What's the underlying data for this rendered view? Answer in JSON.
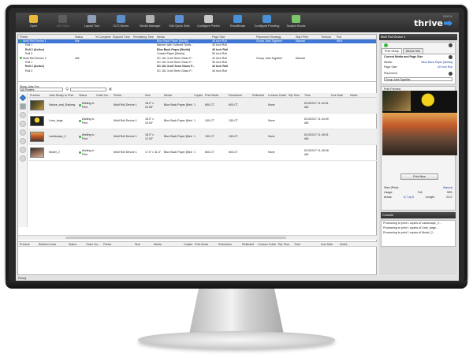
{
  "toolbar": {
    "buttons": [
      {
        "label": "Open",
        "icon": "folder-icon",
        "color": "#e8b93a",
        "disabled": false
      },
      {
        "label": "Job Editor",
        "icon": "job-editor-icon",
        "color": "#7a7a7a",
        "disabled": true
      },
      {
        "label": "Layout Tool",
        "icon": "layout-tool-icon",
        "color": "#8fa0b5",
        "disabled": false
      },
      {
        "label": "CUT-Server",
        "icon": "cut-server-icon",
        "color": "#5c8fc8",
        "disabled": false
      },
      {
        "label": "Media Manager",
        "icon": "media-manager-icon",
        "color": "#b0b0b0",
        "disabled": false
      },
      {
        "label": "Edit Quick Sets",
        "icon": "quick-sets-icon",
        "color": "#5d8fd6",
        "disabled": false
      },
      {
        "label": "Configure Printer",
        "icon": "printer-icon",
        "color": "#c8c8c8",
        "disabled": false
      },
      {
        "label": "Recalibrate",
        "icon": "recalibrate-icon",
        "color": "#4a90d9",
        "disabled": false
      },
      {
        "label": "Configure Proofing",
        "icon": "proofing-icon",
        "color": "#4a90d9",
        "disabled": false
      },
      {
        "label": "Swatch Books",
        "icon": "swatch-books-icon",
        "color": "#7cc46c",
        "disabled": false
      }
    ],
    "brand_small": "ONYX",
    "brand_name": "thrive"
  },
  "printers": {
    "headers": [
      "Printer",
      "Status",
      "% Complete",
      "Elapsed Time",
      "Remaining Time",
      "Media",
      "Page Size",
      "Placement Strategy",
      "Start Print",
      "Timeout",
      "Pull"
    ],
    "rows": [
      {
        "cells": [
          "Multi Roll Device 1",
          "Idle",
          "",
          "",
          "",
          "Blue Back Paper [Media]",
          "40 Inch Roll",
          "Group Jobs Together",
          "Manual",
          "",
          "96%"
        ],
        "selected": true,
        "bold": false,
        "dot": true
      },
      {
        "cells": [
          "Roll 1",
          "",
          "",
          "",
          "",
          "Banner with Outfront Tyvek...",
          "40 Inch Roll",
          "",
          "",
          "",
          ""
        ],
        "selected": false,
        "bold": false,
        "dot": false
      },
      {
        "cells": [
          "Roll 2 (Active)",
          "",
          "",
          "",
          "",
          "Blue Back Paper [Media]",
          "40 Inch Roll",
          "",
          "",
          "",
          ""
        ],
        "selected": false,
        "bold": true,
        "dot": false
      },
      {
        "cells": [
          "Roll 3",
          "",
          "",
          "",
          "",
          "Coated Paper [Media]",
          "50 Inch Roll",
          "",
          "",
          "",
          ""
        ],
        "selected": false,
        "bold": false,
        "dot": false
      },
      {
        "cells": [
          "Multi Roll Device 2",
          "Idle",
          "",
          "",
          "",
          "SC 161 3-mil Semi Gloss P...",
          "42 Inch Roll",
          "Group Jobs Together",
          "Manual",
          "",
          ""
        ],
        "selected": false,
        "bold": false,
        "dot": true
      },
      {
        "cells": [
          "Roll 1",
          "",
          "",
          "",
          "",
          "SC 161 3-mil Semi Gloss P...",
          "36 Inch Roll",
          "",
          "",
          "",
          ""
        ],
        "selected": false,
        "bold": false,
        "dot": false
      },
      {
        "cells": [
          "Roll 2 (Active)",
          "",
          "",
          "",
          "",
          "SC 161 3-mil Semi Gloss P...",
          "42 Inch Roll",
          "",
          "",
          "",
          ""
        ],
        "selected": false,
        "bold": true,
        "dot": false
      },
      {
        "cells": [
          "Roll 3",
          "",
          "",
          "",
          "",
          "SC 161 3-mil Semi Gloss P...",
          "44 Inch Roll",
          "",
          "",
          "",
          ""
        ],
        "selected": false,
        "bold": false,
        "dot": false
      }
    ]
  },
  "show_jobs": {
    "label": "Show Jobs For:",
    "selected": "All Printers"
  },
  "jobs": {
    "headers": [
      "Preview",
      "Jobs Ready to Print",
      "Status",
      "Order Nu...",
      "Printer",
      "Size",
      "Media",
      "Copies",
      "Print Mode",
      "Resolution",
      "Reflected",
      "Contour Cutter",
      "Rip Time",
      "Time",
      "Due Date",
      "Notes"
    ],
    "rows": [
      {
        "thumb": "t1",
        "name": "Nature_and_Railway",
        "status": "Waiting to Print",
        "printer": "Multi Roll Device 1",
        "size": "18.0\" x 24.06\"",
        "media": "Blue Back Paper [Media]",
        "copies": "1",
        "mode": "600-CT",
        "res": "600-CT",
        "cutter": "None",
        "time": "6/13/2017 11:44:41 AM"
      },
      {
        "thumb": "t2",
        "name": "Lime_large",
        "status": "Waiting to Print",
        "printer": "Multi Roll Device 1",
        "size": "18.0\" x 15.00\"",
        "media": "Blue Back Paper [Media]",
        "copies": "1",
        "mode": "150-CT",
        "res": "150-CT",
        "cutter": "None",
        "time": "6/13/2017 11:44:49 AM"
      },
      {
        "thumb": "t3",
        "name": "Landscape_2",
        "status": "Waiting to Print",
        "printer": "Multi Roll Device 1",
        "size": "18.0\" x 12.00\"",
        "media": "Blue Back Paper [Media]",
        "copies": "1",
        "mode": "150-CT",
        "res": "150-CT",
        "cutter": "None",
        "time": "6/13/2017 11:45:01 AM"
      },
      {
        "thumb": "t4",
        "name": "Model_2",
        "status": "Waiting to Print",
        "printer": "Multi Roll Device 1",
        "size": "17.0\" x 11.4\"",
        "media": "Blue Back Paper [Media]",
        "copies": "1",
        "mode": "600-CT",
        "res": "600-CT",
        "cutter": "None",
        "time": "6/13/2017 11:45:08 AM"
      }
    ]
  },
  "buffered": {
    "headers": [
      "Preview",
      "Buffered Jobs",
      "Status",
      "Order Nu...",
      "Printer",
      "Size",
      "Media",
      "Copies",
      "Print Mode",
      "Resolution",
      "Reflected",
      "Contour Cutter",
      "Rip Time",
      "Time",
      "Due Date",
      "Notes"
    ]
  },
  "side": {
    "title": "Multi Roll Device 1",
    "tabs": [
      "Print Setup",
      "Device Info"
    ],
    "media_section": "Current Media and Page Size",
    "media_label": "Media:",
    "media_value": "Blue Back Paper [Media]",
    "page_label": "Page Size:",
    "page_value": "40 Inch Roll",
    "placement_label": "Placement",
    "placement_value": "Group Jobs Together",
    "preview_label": "Print Preview",
    "print_now": "Print Now",
    "start_label": "Start (Print):",
    "start_value": "Manual",
    "usage_label": "Usage:",
    "usage_value": "Full",
    "usage_pct": "96%",
    "areas_label": "Areas:",
    "areas_value": "6.7 sq ft",
    "length_label": "Length:",
    "length_value": "24.2'",
    "console_title": "Console",
    "console_lines": [
      "Processing to print 1 copies of Landscape_2...",
      "Processing to print 1 copies of Lime_large...",
      "Processing to print 1 copies of Model_2..."
    ]
  },
  "status": "Ready"
}
